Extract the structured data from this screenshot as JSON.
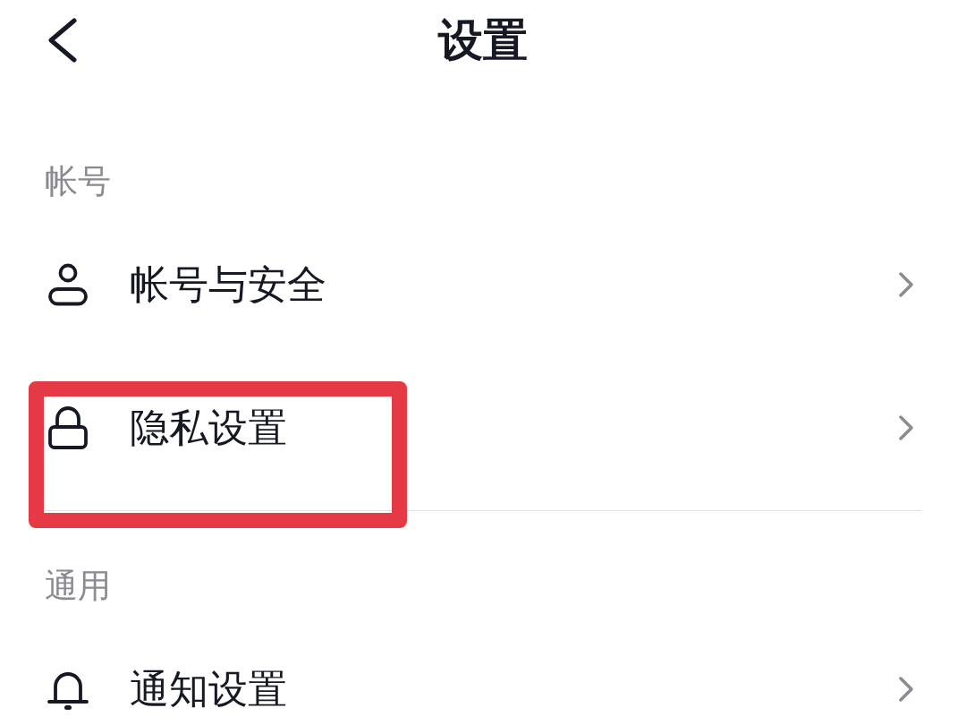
{
  "header": {
    "title": "设置"
  },
  "sections": [
    {
      "title": "帐号",
      "items": [
        {
          "kind": "account",
          "label": "帐号与安全",
          "highlighted": false
        },
        {
          "kind": "privacy",
          "label": "隐私设置",
          "highlighted": true
        }
      ]
    },
    {
      "title": "通用",
      "items": [
        {
          "kind": "notifications",
          "label": "通知设置",
          "highlighted": false
        }
      ]
    }
  ]
}
